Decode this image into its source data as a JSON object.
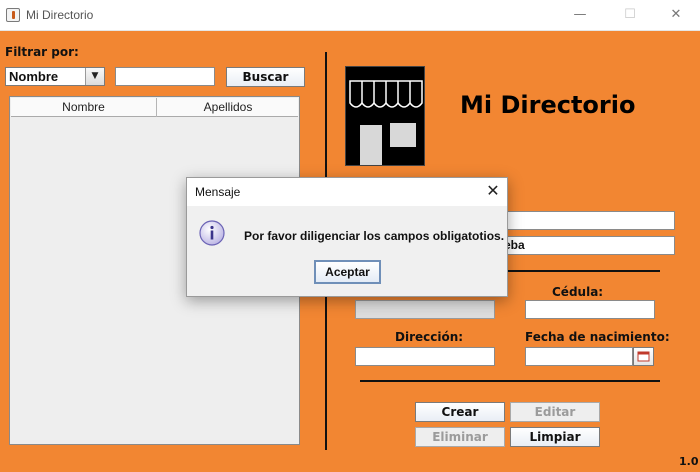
{
  "window": {
    "title": "Mi Directorio",
    "min_glyph": "—",
    "max_glyph": "☐",
    "close_glyph": "✕"
  },
  "filter": {
    "label": "Filtrar por:",
    "select_value": "Nombre",
    "search_value": "",
    "search_button": "Buscar"
  },
  "table": {
    "columns": [
      "Nombre",
      "Apellidos"
    ],
    "rows": []
  },
  "header": {
    "app_title": "Mi Directorio",
    "logo_icon": "storefront-icon"
  },
  "form": {
    "name_value": "",
    "surname_value_visible": "eba",
    "cedula_label": "Cédula:",
    "cedula_value": "",
    "direccion_label": "Dirección:",
    "direccion_value": "",
    "fecha_label": "Fecha de nacimiento:",
    "fecha_value": "",
    "calendar_icon": "calendar-icon"
  },
  "actions": {
    "crear": "Crear",
    "editar": "Editar",
    "eliminar": "Eliminar",
    "limpiar": "Limpiar"
  },
  "version": "1.0",
  "dialog": {
    "title": "Mensaje",
    "close_glyph": "✕",
    "icon": "info-icon",
    "message": "Por favor diligenciar los campos obligatotios.",
    "ok_button": "Aceptar"
  },
  "colors": {
    "background": "#f28632",
    "dialog": "#f0f0f0"
  }
}
